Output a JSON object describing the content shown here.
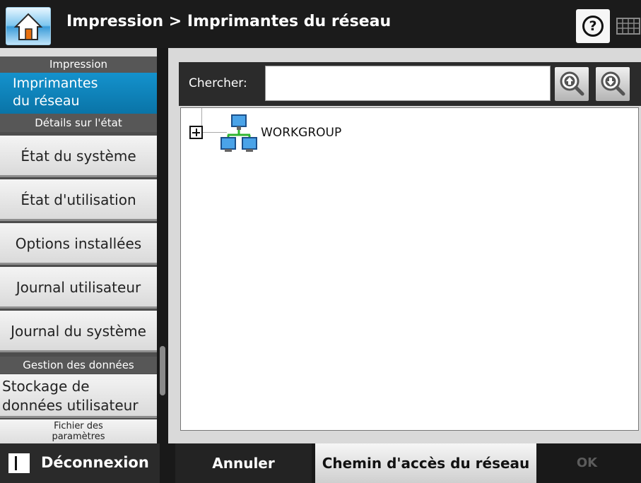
{
  "header": {
    "title": "Impression > Imprimantes du réseau",
    "home_icon": "home-icon",
    "help_icon": "help-icon",
    "keyboard_icon": "keyboard-icon"
  },
  "sidebar": {
    "section_impression": "Impression",
    "active_item": {
      "line1": "Imprimantes",
      "line2": "du réseau"
    },
    "section_details": "Détails sur l'état",
    "items": [
      {
        "label": "État du système"
      },
      {
        "label": "État d'utilisation"
      },
      {
        "label": "Options installées"
      },
      {
        "label": "Journal utilisateur"
      },
      {
        "label": "Journal du système"
      }
    ],
    "section_data": "Gestion des données",
    "data_item": {
      "line1": "Stockage de",
      "line2": "données utilisateur"
    },
    "partial_item": {
      "line1": "Fichier des",
      "line2": "paramètres"
    }
  },
  "main": {
    "search_label": "Chercher:",
    "search_value": "",
    "tree": {
      "nodes": [
        {
          "label": "WORKGROUP",
          "icon": "network-icon",
          "expanded": false
        }
      ]
    }
  },
  "footer": {
    "logout_label": "Déconnexion",
    "cancel_label": "Annuler",
    "path_label": "Chemin d'accès du réseau",
    "ok_label": "OK"
  },
  "colors": {
    "accent_blue": "#0a80b9",
    "background_dark": "#1b1b1b",
    "sidebar_bg": "#4d4d4d"
  }
}
